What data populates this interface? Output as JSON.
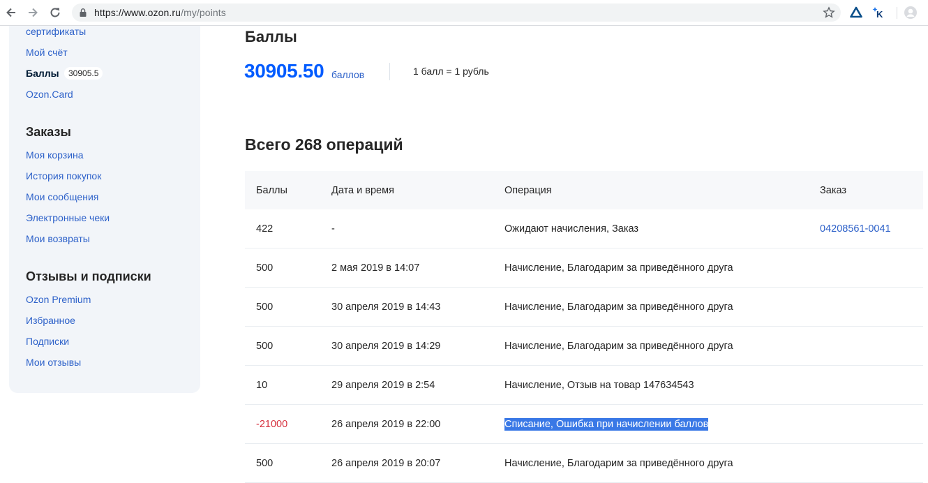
{
  "browser": {
    "url_host": "https://www.ozon.ru",
    "url_path": "/my/points"
  },
  "sidebar": {
    "items_top": [
      {
        "label": "сертификаты"
      },
      {
        "label": "Мой счёт"
      },
      {
        "label": "Баллы",
        "badge": "30905.5",
        "active": true
      },
      {
        "label": "Ozon.Card"
      }
    ],
    "section_orders": {
      "heading": "Заказы",
      "items": [
        "Моя корзина",
        "История покупок",
        "Мои сообщения",
        "Электронные чеки",
        "Мои возвраты"
      ]
    },
    "section_reviews": {
      "heading": "Отзывы и подписки",
      "items": [
        "Ozon Premium",
        "Избранное",
        "Подписки",
        "Мои отзывы"
      ]
    }
  },
  "main": {
    "title": "Баллы",
    "balance": "30905.50",
    "balance_unit": "баллов",
    "rate": "1 балл = 1 рубль",
    "ops_title": "Всего 268 операций",
    "table": {
      "headers": [
        "Баллы",
        "Дата и время",
        "Операция",
        "Заказ"
      ],
      "rows": [
        {
          "points": "422",
          "date": "-",
          "operation": "Ожидают начисления, Заказ",
          "order": "04208561-0041"
        },
        {
          "points": "500",
          "date": "2 мая 2019 в 14:07",
          "operation": "Начисление, Благодарим за приведённого друга",
          "order": ""
        },
        {
          "points": "500",
          "date": "30 апреля 2019 в 14:43",
          "operation": "Начисление, Благодарим за приведённого друга",
          "order": ""
        },
        {
          "points": "500",
          "date": "30 апреля 2019 в 14:29",
          "operation": "Начисление, Благодарим за приведённого друга",
          "order": ""
        },
        {
          "points": "10",
          "date": "29 апреля 2019 в 2:54",
          "operation": "Начисление, Отзыв на товар 147634543",
          "order": ""
        },
        {
          "points": "-21000",
          "date": "26 апреля 2019 в 22:00",
          "operation": "Списание, Ошибка при начислении баллов",
          "order": ""
        },
        {
          "points": "500",
          "date": "26 апреля 2019 в 20:07",
          "operation": "Начисление, Благодарим за приведённого друга",
          "order": ""
        }
      ]
    }
  },
  "colors": {
    "accent": "#005bff",
    "link": "#2d61c9",
    "negative": "#d6323f",
    "selection": "#3978e6",
    "sidebar_bg": "#f2f5f9"
  }
}
